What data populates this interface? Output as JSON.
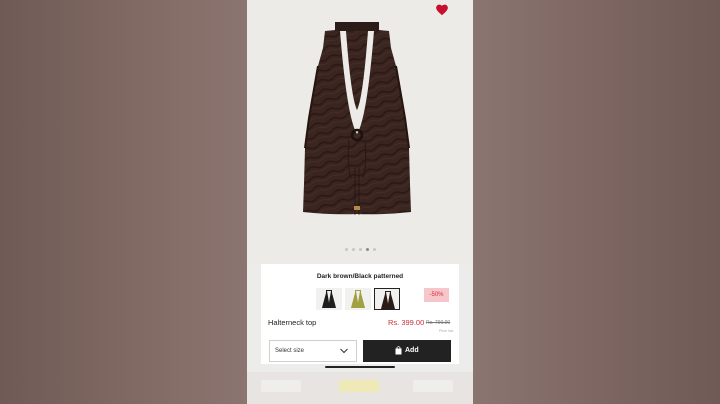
{
  "product": {
    "color_name": "Dark brown/Black patterned",
    "name": "Halterneck top",
    "price": "Rs. 399.00",
    "original_price": "Rs. 799.00",
    "price_note": "Price incl.",
    "discount": "-50%"
  },
  "gallery": {
    "image_count": 5,
    "active_index": 3,
    "wishlist_active": true
  },
  "swatches": [
    {
      "name": "black",
      "color": "#1e1e1e",
      "selected": false
    },
    {
      "name": "olive",
      "color": "#a1a043",
      "selected": false
    },
    {
      "name": "dark-brown-black-patterned",
      "color": "#2b1c17",
      "selected": true
    }
  ],
  "actions": {
    "size_label": "Select size",
    "add_label": "Add"
  },
  "colors": {
    "accent_red": "#c62f3c",
    "button_dark": "#222222",
    "badge_bg": "#f7c6ca"
  }
}
